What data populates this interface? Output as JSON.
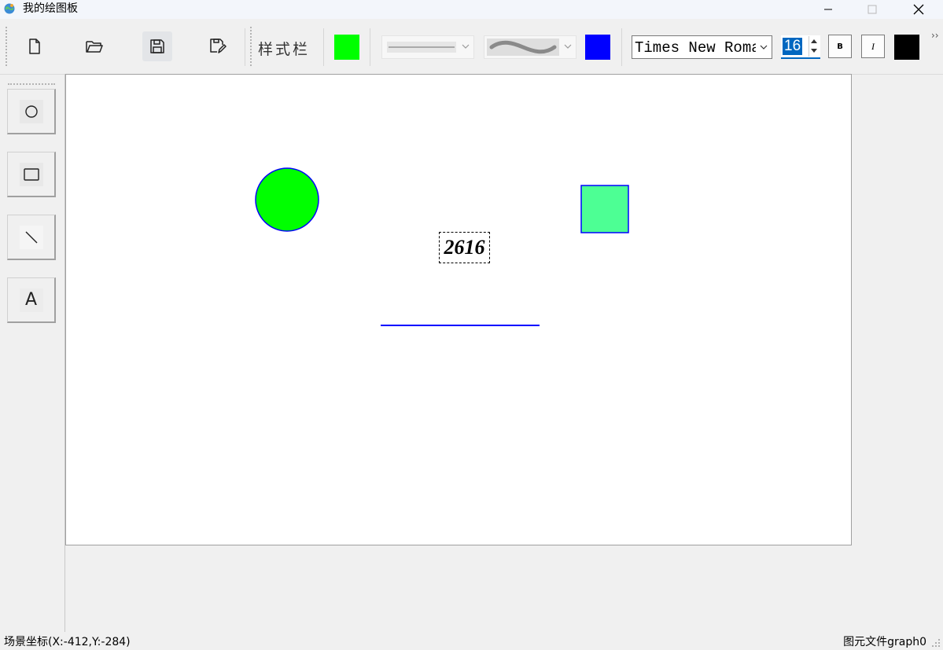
{
  "window": {
    "title": "我的绘图板",
    "icon": "globe-paint-icon"
  },
  "toolbar": {
    "file_buttons": [
      {
        "name": "new-file-button",
        "icon": "new-file-icon"
      },
      {
        "name": "open-file-button",
        "icon": "open-folder-icon"
      },
      {
        "name": "save-button",
        "icon": "save-icon"
      },
      {
        "name": "save-as-button",
        "icon": "save-as-icon"
      }
    ],
    "style_label": "样式栏",
    "fill_color": "#00ff00",
    "line_style": "solid",
    "line_style_icon": "straight-line-icon",
    "brush_style": "wave",
    "brush_style_icon": "wave-line-icon",
    "line_color": "#0000ff",
    "font_family": "Times New Roman",
    "font_size": "16",
    "bold_label": "B",
    "italic_label": "I",
    "text_color": "#000000",
    "overflow_label": "››"
  },
  "tools": [
    {
      "name": "circle-tool",
      "icon": "circle-icon"
    },
    {
      "name": "rectangle-tool",
      "icon": "rectangle-icon"
    },
    {
      "name": "line-tool",
      "icon": "line-icon"
    },
    {
      "name": "text-tool",
      "icon": "text-icon",
      "label": "A"
    }
  ],
  "canvas": {
    "shapes": [
      {
        "type": "circle",
        "fill": "#00ff00",
        "stroke": "#0000ff"
      },
      {
        "type": "square",
        "fill": "#4dff94",
        "stroke": "#0000ff"
      },
      {
        "type": "text",
        "text": "2616",
        "selected": true
      },
      {
        "type": "line",
        "stroke": "#0000ff"
      }
    ]
  },
  "status": {
    "scene_coords": "场景坐标(X:-412,Y:-284)",
    "file_label": "图元文件graph0"
  }
}
